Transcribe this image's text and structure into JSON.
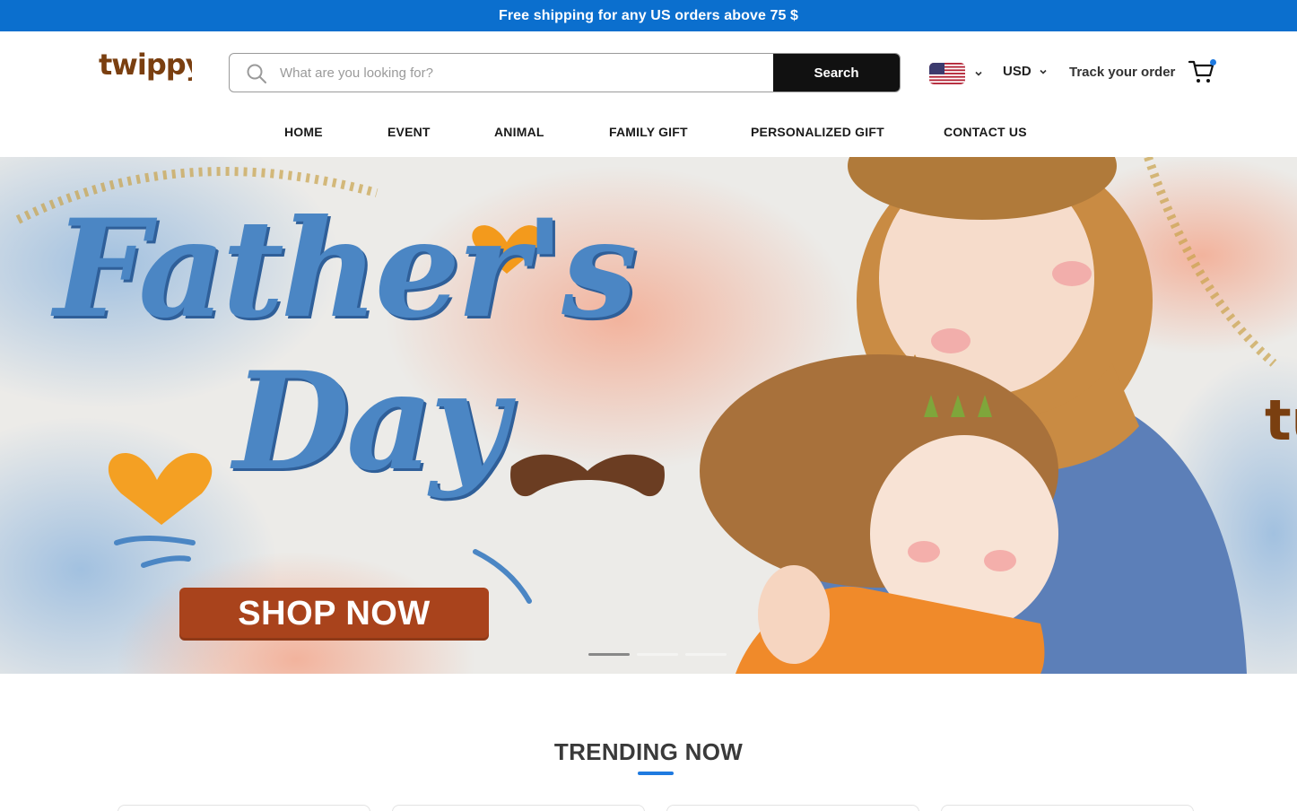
{
  "announcement": {
    "text": "Free shipping for any US orders above 75 $"
  },
  "header": {
    "logo_text": "twippy",
    "search": {
      "placeholder": "What are you looking for?",
      "value": "",
      "button_label": "Search"
    },
    "country": {
      "flag": "us-flag-icon"
    },
    "currency": {
      "selected": "USD"
    },
    "track_label": "Track your order",
    "cart": {
      "icon": "cart-icon",
      "badge_color": "#1f7ae0"
    }
  },
  "nav": {
    "items": [
      {
        "label": "HOME"
      },
      {
        "label": "EVENT"
      },
      {
        "label": "ANIMAL"
      },
      {
        "label": "FAMILY GIFT"
      },
      {
        "label": "PERSONALIZED GIFT"
      },
      {
        "label": "CONTACT US"
      }
    ]
  },
  "hero": {
    "title_line1": "Father's",
    "title_line2": "Day",
    "cta_label": "SHOP NOW",
    "slide_count": 3,
    "active_slide": 1,
    "peek_text": "tu"
  },
  "trending": {
    "title": "TRENDING NOW"
  },
  "colors": {
    "brand_blue": "#0b6fce",
    "accent_blue": "#1f7ae0",
    "logo_brown": "#7a3f10",
    "cta_brown": "#a9431c",
    "dark_button": "#111111"
  }
}
